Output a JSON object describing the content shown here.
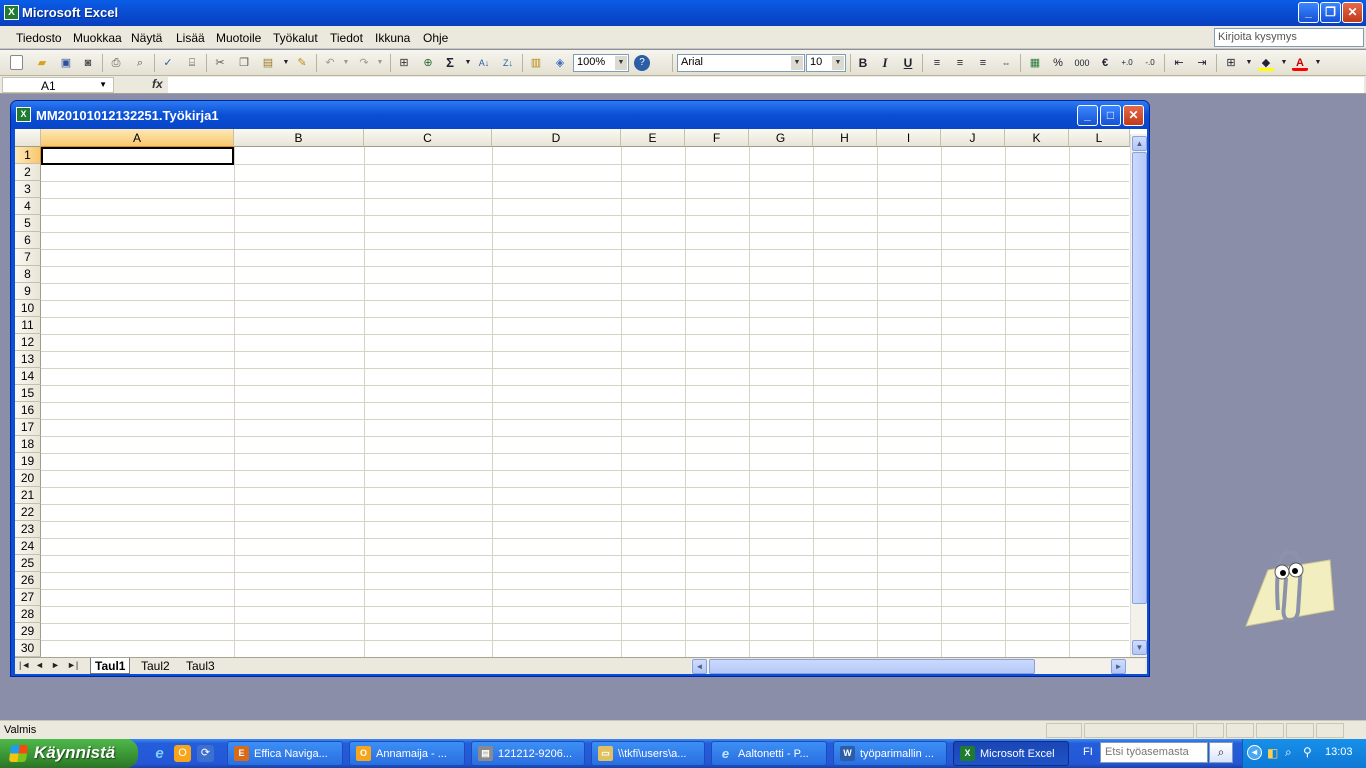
{
  "app": {
    "title": "Microsoft Excel",
    "icon": "excel-icon"
  },
  "window_buttons": {
    "minimize": "_",
    "restore": "❐",
    "close": "✕"
  },
  "menu": [
    "Tiedosto",
    "Muokkaa",
    "Näytä",
    "Lisää",
    "Muotoile",
    "Työkalut",
    "Tiedot",
    "Ikkuna",
    "Ohje"
  ],
  "ask_box": {
    "placeholder": "Kirjoita kysymys"
  },
  "toolbar": {
    "zoom": "100%",
    "font": "Arial",
    "font_size": "10",
    "bold": "B",
    "italic": "I",
    "underline": "U",
    "percent": "%",
    "thousands": "000",
    "euro": "€",
    "autosum": "Σ",
    "fill_color": "#ffff00",
    "font_color": "#ff0000"
  },
  "formula_bar": {
    "name_box": "A1",
    "fx": "fx",
    "content": ""
  },
  "workbook": {
    "title": "MM20101012132251.Työkirja1",
    "columns": [
      "A",
      "B",
      "C",
      "D",
      "E",
      "F",
      "G",
      "H",
      "I",
      "J",
      "K",
      "L"
    ],
    "rows": [
      "1",
      "2",
      "3",
      "4",
      "5",
      "6",
      "7",
      "8",
      "9",
      "10",
      "11",
      "12",
      "13",
      "14",
      "15",
      "16",
      "17",
      "18",
      "19",
      "20",
      "21",
      "22",
      "23",
      "24",
      "25",
      "26",
      "27",
      "28",
      "29",
      "30"
    ],
    "selected_cell": "A1",
    "sheets": [
      "Taul1",
      "Taul2",
      "Taul3"
    ],
    "active_sheet": "Taul1"
  },
  "status": {
    "text": "Valmis"
  },
  "taskbar": {
    "start": "Käynnistä",
    "quick_launch": [
      "ie-icon",
      "opera-icon",
      "refresh-icon"
    ],
    "buttons": [
      {
        "label": "Effica Naviga...",
        "icon": "effica-icon"
      },
      {
        "label": "Annamaija - ...",
        "icon": "opera-icon"
      },
      {
        "label": "121212-9206...",
        "icon": "document-icon"
      },
      {
        "label": "\\\\tkfi\\users\\a...",
        "icon": "folder-icon"
      },
      {
        "label": "Aaltonetti - P...",
        "icon": "ie-icon"
      },
      {
        "label": "työparimallin ...",
        "icon": "word-icon"
      },
      {
        "label": "Microsoft Excel",
        "icon": "excel-icon",
        "active": true
      }
    ],
    "lang": "FI",
    "search_placeholder": "Etsi työasemasta",
    "clock": "13:03"
  }
}
